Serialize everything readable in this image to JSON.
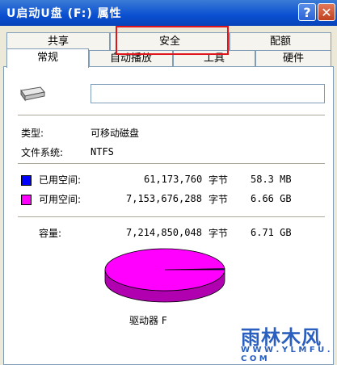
{
  "window": {
    "title": "U启动U盘 (F:) 属性",
    "help_label": "?",
    "close_label": "✕"
  },
  "tabs": {
    "row_top": [
      "共享",
      "安全",
      "配额"
    ],
    "row_bottom": [
      "常规",
      "自动播放",
      "工具",
      "硬件"
    ],
    "active": "常规",
    "highlighted": "安全"
  },
  "general": {
    "type_label": "类型:",
    "type_value": "可移动磁盘",
    "fs_label": "文件系统:",
    "fs_value": "NTFS",
    "used_label": "已用空间:",
    "used_bytes": "61,173,760",
    "used_unit": "字节",
    "used_size": "58.3 MB",
    "free_label": "可用空间:",
    "free_bytes": "7,153,676,288",
    "free_unit": "字节",
    "free_size": "6.66 GB",
    "capacity_label": "容量:",
    "capacity_bytes": "7,214,850,048",
    "capacity_unit": "字节",
    "capacity_size": "6.71 GB",
    "drive_label": "驱动器 F"
  },
  "colors": {
    "used": "#0000ff",
    "free": "#ff00ff",
    "highlight": "#e0141b"
  },
  "chart_data": {
    "type": "pie",
    "slices": [
      {
        "label": "已用空间",
        "value": 61173760
      },
      {
        "label": "可用空间",
        "value": 7153676288
      }
    ]
  },
  "watermark": {
    "main": "雨林木风",
    "sub": "W W W . Y L M F U . C O M"
  }
}
